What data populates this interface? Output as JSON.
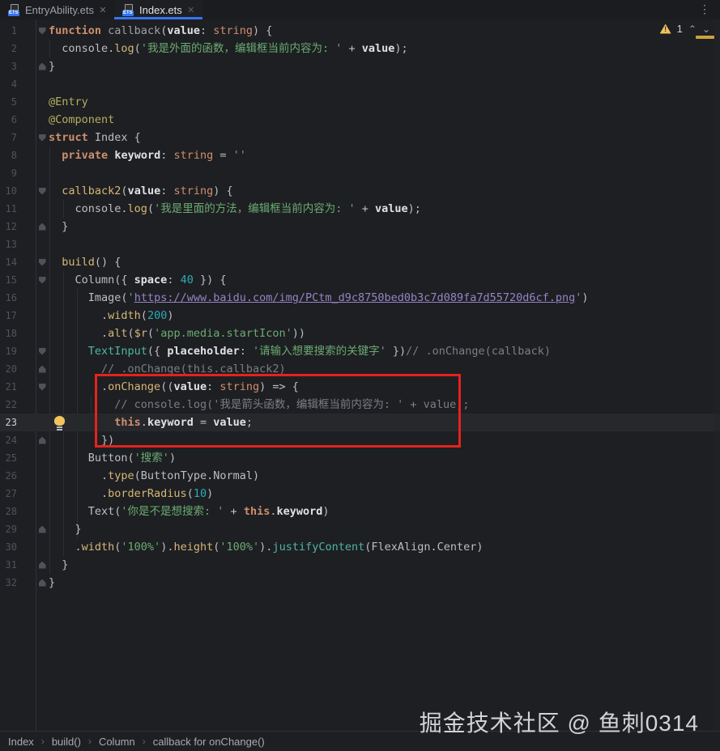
{
  "tabs": [
    {
      "label": "EntryAbility.ets",
      "active": false
    },
    {
      "label": "Index.ets",
      "active": true
    }
  ],
  "ets_icon_label": "ETS",
  "inspections": {
    "warning_count": "1"
  },
  "breadcrumbs": [
    "Index",
    "build()",
    "Column",
    "callback for onChange()"
  ],
  "watermark": "掘金技术社区 @ 鱼刺0314",
  "colors": {
    "editor_bg": "#1e1f22",
    "accent_blue": "#3574f0",
    "annotation_red": "#e3231c",
    "warning_yellow": "#efc35c",
    "keyword_orange": "#cf8e6d",
    "function_yellow": "#d5b778",
    "string_green": "#6aab73",
    "number_teal": "#2aacb8",
    "comment_gray": "#7a7e85"
  },
  "editor": {
    "lines": [
      {
        "n": 1,
        "fold": "open",
        "t": [
          [
            "kw",
            "function"
          ],
          [
            "pl",
            " "
          ],
          [
            "gy",
            "callback"
          ],
          [
            "pl",
            "("
          ],
          [
            "pr",
            "value"
          ],
          [
            "pl",
            ": "
          ],
          [
            "ty",
            "string"
          ],
          [
            "pl",
            ") {"
          ]
        ]
      },
      {
        "n": 2,
        "t": [
          [
            "pl",
            "  console."
          ],
          [
            "fn",
            "log"
          ],
          [
            "pl",
            "("
          ],
          [
            "str",
            "'我是外面的函数，编辑框当前内容为: '"
          ],
          [
            "pl",
            " + "
          ],
          [
            "pr",
            "value"
          ],
          [
            "pl",
            ");"
          ]
        ]
      },
      {
        "n": 3,
        "fold": "end",
        "t": [
          [
            "pl",
            "}"
          ]
        ]
      },
      {
        "n": 4,
        "t": []
      },
      {
        "n": 5,
        "t": [
          [
            "an",
            "@Entry"
          ]
        ]
      },
      {
        "n": 6,
        "t": [
          [
            "an",
            "@Component"
          ]
        ]
      },
      {
        "n": 7,
        "fold": "open",
        "t": [
          [
            "kw",
            "struct"
          ],
          [
            "pl",
            " Index {"
          ]
        ]
      },
      {
        "n": 8,
        "t": [
          [
            "pl",
            "  "
          ],
          [
            "kw",
            "private"
          ],
          [
            "pl",
            " "
          ],
          [
            "pr",
            "keyword"
          ],
          [
            "pl",
            ": "
          ],
          [
            "ty",
            "string"
          ],
          [
            "pl",
            " = "
          ],
          [
            "str",
            "''"
          ]
        ]
      },
      {
        "n": 9,
        "t": []
      },
      {
        "n": 10,
        "fold": "open",
        "t": [
          [
            "pl",
            "  "
          ],
          [
            "fn",
            "callback2"
          ],
          [
            "pl",
            "("
          ],
          [
            "pr",
            "value"
          ],
          [
            "pl",
            ": "
          ],
          [
            "ty",
            "string"
          ],
          [
            "pl",
            ") {"
          ]
        ]
      },
      {
        "n": 11,
        "t": [
          [
            "pl",
            "    console."
          ],
          [
            "fn",
            "log"
          ],
          [
            "pl",
            "("
          ],
          [
            "str",
            "'我是里面的方法，编辑框当前内容为: '"
          ],
          [
            "pl",
            " + "
          ],
          [
            "pr",
            "value"
          ],
          [
            "pl",
            ");"
          ]
        ]
      },
      {
        "n": 12,
        "fold": "end",
        "t": [
          [
            "pl",
            "  }"
          ]
        ]
      },
      {
        "n": 13,
        "t": []
      },
      {
        "n": 14,
        "fold": "open",
        "t": [
          [
            "pl",
            "  "
          ],
          [
            "fn",
            "build"
          ],
          [
            "pl",
            "() {"
          ]
        ]
      },
      {
        "n": 15,
        "fold": "open",
        "t": [
          [
            "pl",
            "    Column({ "
          ],
          [
            "pr",
            "space"
          ],
          [
            "pl",
            ": "
          ],
          [
            "num",
            "40"
          ],
          [
            "pl",
            " }) {"
          ]
        ]
      },
      {
        "n": 16,
        "t": [
          [
            "pl",
            "      Image("
          ],
          [
            "str",
            "'"
          ],
          [
            "lk",
            "https://www.baidu.com/img/PCtm_d9c8750bed0b3c7d089fa7d55720d6cf.png"
          ],
          [
            "str",
            "'"
          ],
          [
            "pl",
            ")"
          ]
        ]
      },
      {
        "n": 17,
        "t": [
          [
            "pl",
            "        ."
          ],
          [
            "fn",
            "width"
          ],
          [
            "pl",
            "("
          ],
          [
            "num",
            "200"
          ],
          [
            "pl",
            ")"
          ]
        ]
      },
      {
        "n": 18,
        "t": [
          [
            "pl",
            "        ."
          ],
          [
            "fn",
            "alt"
          ],
          [
            "pl",
            "("
          ],
          [
            "fn",
            "$r"
          ],
          [
            "pl",
            "("
          ],
          [
            "str",
            "'app.media.startIcon'"
          ],
          [
            "pl",
            "))"
          ]
        ]
      },
      {
        "n": 19,
        "fold": "open",
        "t": [
          [
            "tl",
            "      TextInput"
          ],
          [
            "pl",
            "({ "
          ],
          [
            "pr",
            "placeholder"
          ],
          [
            "pl",
            ": "
          ],
          [
            "str",
            "'请输入想要搜索的关键字'"
          ],
          [
            "pl",
            " })"
          ],
          [
            "cmt",
            "// .onChange(callback)"
          ]
        ]
      },
      {
        "n": 20,
        "fold": "end",
        "t": [
          [
            "pl",
            "        "
          ],
          [
            "cmt",
            "// .onChange(this.callback2)"
          ]
        ]
      },
      {
        "n": 21,
        "fold": "open",
        "t": [
          [
            "pl",
            "        ."
          ],
          [
            "fn",
            "onChange"
          ],
          [
            "pl",
            "(("
          ],
          [
            "pr",
            "value"
          ],
          [
            "pl",
            ": "
          ],
          [
            "ty",
            "string"
          ],
          [
            "pl",
            ") => {"
          ]
        ]
      },
      {
        "n": 22,
        "t": [
          [
            "pl",
            "          "
          ],
          [
            "cmt",
            "// console.log('我是箭头函数，编辑框当前内容为: ' + value);"
          ]
        ]
      },
      {
        "n": 23,
        "current": true,
        "bulb": true,
        "t": [
          [
            "pl",
            "          "
          ],
          [
            "kw",
            "this"
          ],
          [
            "pl",
            "."
          ],
          [
            "pr",
            "keyword"
          ],
          [
            "pl",
            " = "
          ],
          [
            "pr",
            "value"
          ],
          [
            "pl",
            ";"
          ]
        ]
      },
      {
        "n": 24,
        "fold": "end",
        "t": [
          [
            "pl",
            "        })"
          ]
        ]
      },
      {
        "n": 25,
        "t": [
          [
            "pl",
            "      Button("
          ],
          [
            "str",
            "'搜索'"
          ],
          [
            "pl",
            ")"
          ]
        ]
      },
      {
        "n": 26,
        "t": [
          [
            "pl",
            "        ."
          ],
          [
            "fn",
            "type"
          ],
          [
            "pl",
            "(ButtonType.Normal)"
          ]
        ]
      },
      {
        "n": 27,
        "t": [
          [
            "pl",
            "        ."
          ],
          [
            "fn",
            "borderRadius"
          ],
          [
            "pl",
            "("
          ],
          [
            "num",
            "10"
          ],
          [
            "pl",
            ")"
          ]
        ]
      },
      {
        "n": 28,
        "t": [
          [
            "pl",
            "      Text("
          ],
          [
            "str",
            "'你是不是想搜索: '"
          ],
          [
            "pl",
            " + "
          ],
          [
            "kw",
            "this"
          ],
          [
            "pl",
            "."
          ],
          [
            "pr",
            "keyword"
          ],
          [
            "pl",
            ")"
          ]
        ]
      },
      {
        "n": 29,
        "fold": "end",
        "t": [
          [
            "pl",
            "    }"
          ]
        ]
      },
      {
        "n": 30,
        "t": [
          [
            "pl",
            "    ."
          ],
          [
            "fn",
            "width"
          ],
          [
            "pl",
            "("
          ],
          [
            "str",
            "'100%'"
          ],
          [
            "pl",
            ")."
          ],
          [
            "fn",
            "height"
          ],
          [
            "pl",
            "("
          ],
          [
            "str",
            "'100%'"
          ],
          [
            "pl",
            ")."
          ],
          [
            "tl",
            "justifyContent"
          ],
          [
            "pl",
            "(FlexAlign.Center)"
          ]
        ]
      },
      {
        "n": 31,
        "fold": "end",
        "t": [
          [
            "pl",
            "  }"
          ]
        ]
      },
      {
        "n": 32,
        "fold": "end",
        "t": [
          [
            "pl",
            "}"
          ]
        ]
      }
    ]
  }
}
